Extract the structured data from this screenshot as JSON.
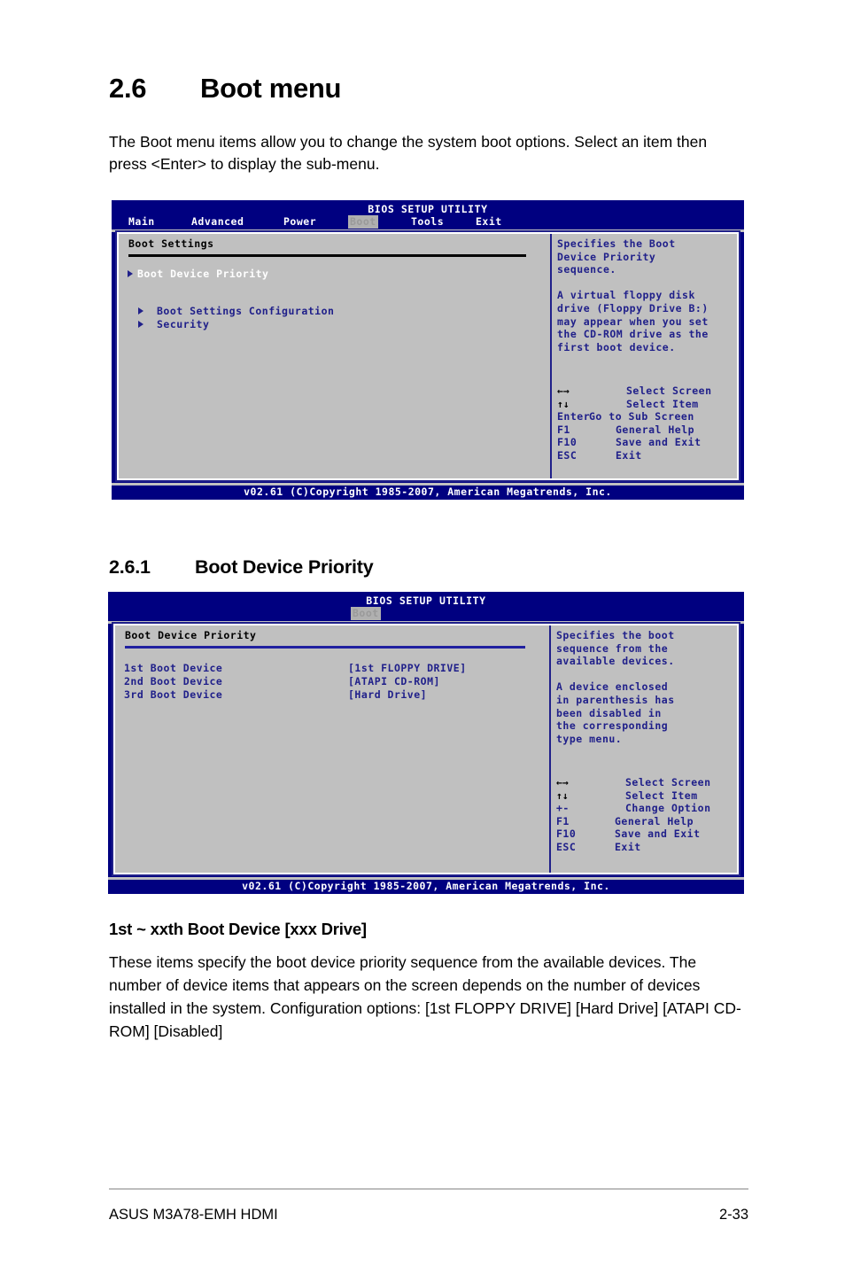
{
  "document": {
    "section_number": "2.6",
    "section_title": "Boot menu",
    "intro": "The Boot menu items allow you to change the system boot options. Select an item then press <Enter> to display the sub-menu.",
    "subsection_number": "2.6.1",
    "subsection_title": "Boot Device Priority",
    "item_heading": "1st ~ xxth Boot Device [xxx Drive]",
    "item_body": "These items specify the boot device priority sequence from the available devices. The number of device items that appears on the screen depends on the number of devices installed in the system. Configuration options: [1st FLOPPY DRIVE] [Hard Drive] [ATAPI CD-ROM] [Disabled]",
    "footer_left": "ASUS M3A78-EMH HDMI",
    "footer_right": "2-33"
  },
  "bios_screen_1": {
    "title": "BIOS SETUP UTILITY",
    "tabs": [
      {
        "label": "Main",
        "active": false
      },
      {
        "label": "Advanced",
        "active": false
      },
      {
        "label": "Power",
        "active": false
      },
      {
        "label": "Boot",
        "active": true
      },
      {
        "label": "Tools",
        "active": false
      },
      {
        "label": "Exit",
        "active": false
      }
    ],
    "panel_heading": "Boot Settings",
    "menu_items": [
      {
        "label": "Boot Device Priority",
        "selected": true
      },
      {
        "label": "Boot Settings Configuration",
        "selected": false
      },
      {
        "label": "Security",
        "selected": false
      }
    ],
    "help_text": "Specifies the Boot\nDevice Priority\nsequence.\n\nA virtual floppy disk\ndrive (Floppy Drive B:)\nmay appear when you set\nthe CD-ROM drive as the\nfirst boot device.",
    "keys": [
      {
        "key": "arrows-lr",
        "glyph": "←→",
        "label": "Select Screen"
      },
      {
        "key": "arrows-ud",
        "glyph": "↑↓",
        "label": "Select Item"
      },
      {
        "key": "Enter",
        "glyph": "",
        "label": "Go to Sub Screen"
      },
      {
        "key": "F1",
        "glyph": "",
        "label": "General Help"
      },
      {
        "key": "F10",
        "glyph": "",
        "label": "Save and Exit"
      },
      {
        "key": "ESC",
        "glyph": "",
        "label": "Exit"
      }
    ],
    "copyright": "v02.61 (C)Copyright 1985-2007, American Megatrends, Inc."
  },
  "bios_screen_2": {
    "title": "BIOS SETUP UTILITY",
    "tabs": [
      {
        "label": "Boot",
        "active": true
      }
    ],
    "panel_heading": "Boot Device Priority",
    "options": [
      {
        "label": "1st Boot Device",
        "value": "[1st FLOPPY DRIVE]"
      },
      {
        "label": "2nd Boot Device",
        "value": "[ATAPI CD-ROM]"
      },
      {
        "label": "3rd Boot Device",
        "value": "[Hard Drive]"
      }
    ],
    "help_text": "Specifies the boot\nsequence from the\navailable devices.\n\nA device enclosed\nin parenthesis has\nbeen disabled in\nthe corresponding\ntype menu.",
    "keys": [
      {
        "key": "arrows-lr",
        "glyph": "←→",
        "label": "Select Screen"
      },
      {
        "key": "arrows-ud",
        "glyph": "↑↓",
        "label": "Select Item"
      },
      {
        "key": "plus-minus",
        "glyph": "+-",
        "label": "Change Option"
      },
      {
        "key": "F1",
        "glyph": "",
        "label": "General Help"
      },
      {
        "key": "F10",
        "glyph": "",
        "label": "Save and Exit"
      },
      {
        "key": "ESC",
        "glyph": "",
        "label": "Exit"
      }
    ],
    "copyright": "v02.61 (C)Copyright 1985-2007, American Megatrends, Inc."
  },
  "colors": {
    "bios_background": "#000080",
    "panel_background": "#c0c0c0",
    "panel_text": "#20208a",
    "selected_text": "#ffffff",
    "heading_text": "#000000",
    "active_tab_background": "#b0b0b0"
  }
}
